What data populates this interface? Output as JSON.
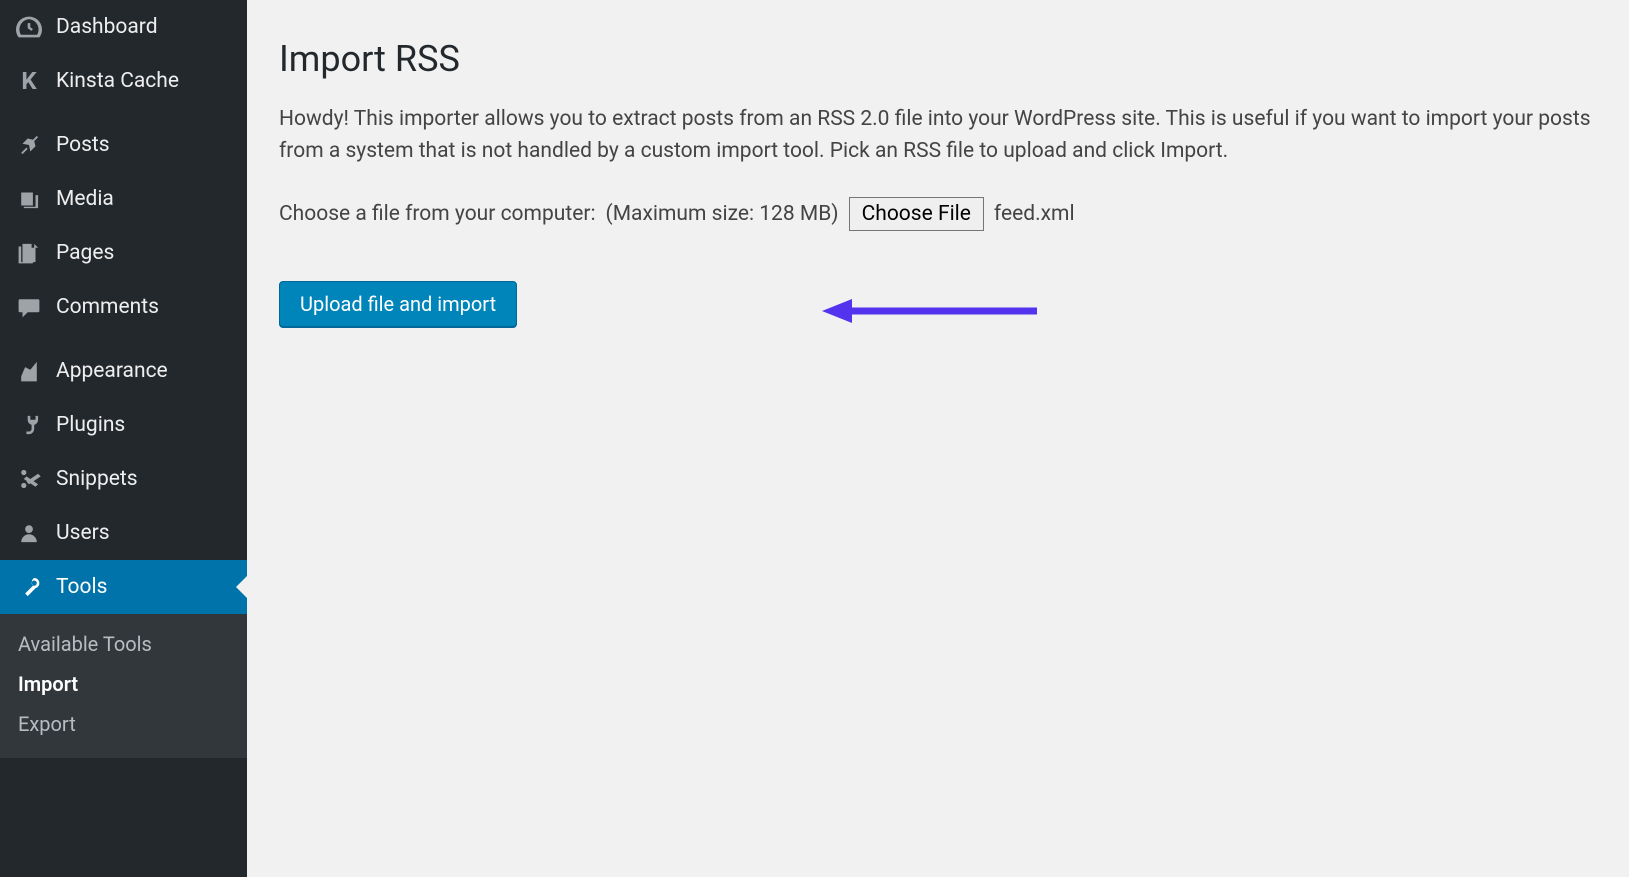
{
  "sidebar": {
    "items": [
      {
        "label": "Dashboard",
        "icon": "dashboard"
      },
      {
        "label": "Kinsta Cache",
        "icon": "kinsta"
      },
      {
        "label": "Posts",
        "icon": "pin"
      },
      {
        "label": "Media",
        "icon": "media"
      },
      {
        "label": "Pages",
        "icon": "pages"
      },
      {
        "label": "Comments",
        "icon": "comments"
      },
      {
        "label": "Appearance",
        "icon": "appearance"
      },
      {
        "label": "Plugins",
        "icon": "plugins"
      },
      {
        "label": "Snippets",
        "icon": "snippets"
      },
      {
        "label": "Users",
        "icon": "users"
      },
      {
        "label": "Tools",
        "icon": "tools"
      }
    ],
    "submenu": [
      {
        "label": "Available Tools"
      },
      {
        "label": "Import"
      },
      {
        "label": "Export"
      }
    ]
  },
  "page": {
    "title": "Import RSS",
    "intro": "Howdy! This importer allows you to extract posts from an RSS 2.0 file into your WordPress site. This is useful if you want to import your posts from a system that is not handled by a custom import tool. Pick an RSS file to upload and click Import.",
    "choose_label": "Choose a file from your computer:",
    "max_size": "(Maximum size: 128 MB)",
    "choose_button": "Choose File",
    "filename": "feed.xml",
    "submit_button": "Upload file and import"
  },
  "colors": {
    "accent_blue": "#0073aa",
    "button_blue": "#0085ba",
    "arrow_purple": "#5333ed"
  }
}
